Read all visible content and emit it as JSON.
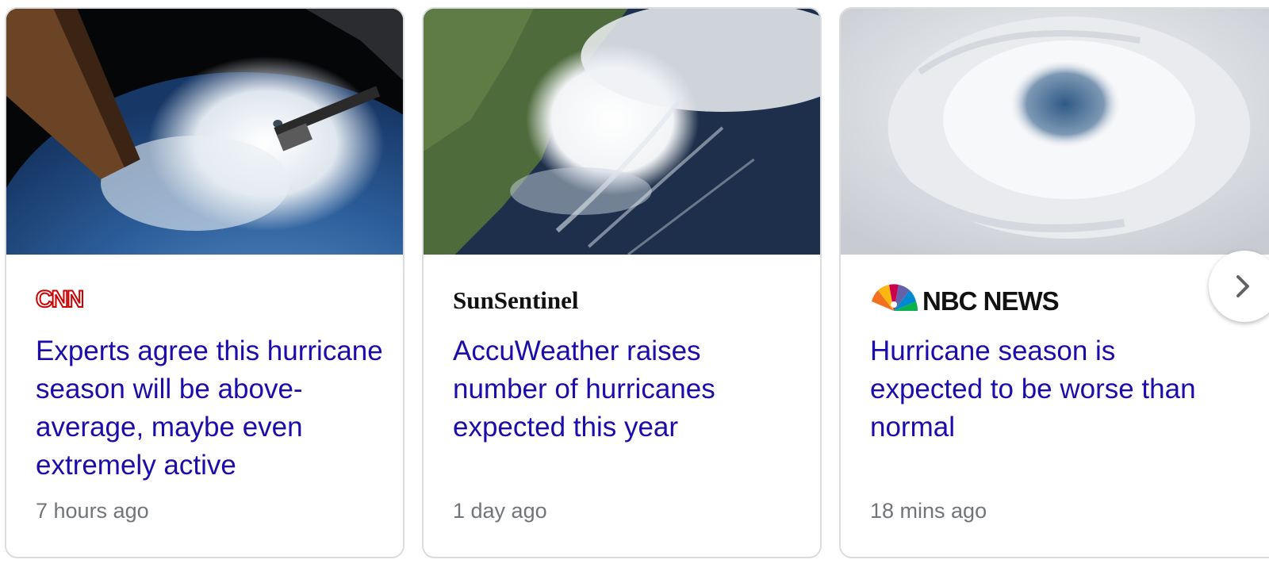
{
  "cards": [
    {
      "source": "CNN",
      "headline": "Experts agree this hurricane season will be above-average, maybe even extremely active",
      "time": "7 hours ago",
      "thumbnail": "hurricane-from-space-station"
    },
    {
      "source": "SunSentinel",
      "headline": "AccuWeather raises number of hurricanes expected this year",
      "time": "1 day ago",
      "thumbnail": "hurricane-over-coastline"
    },
    {
      "source": "NBC NEWS",
      "headline": "Hurricane season is expected to be worse than normal",
      "time": "18 mins ago",
      "thumbnail": "hurricane-eye-closeup"
    }
  ],
  "colors": {
    "headline": "#1a0dab",
    "timestamp": "#70757a",
    "border": "#dadce0",
    "cnn_red": "#cc0000"
  },
  "next_button_icon": "chevron-right-icon"
}
